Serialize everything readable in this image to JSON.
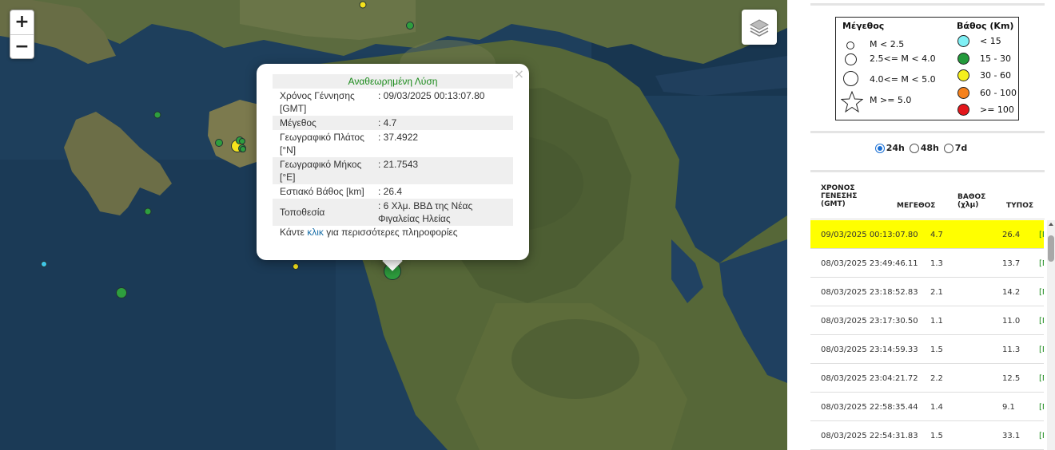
{
  "map": {
    "zoom_in_label": "+",
    "zoom_out_label": "−",
    "layers_icon": "layers-icon",
    "earthquakes": [
      {
        "depth_class": "15 - 30",
        "color": "#2e9e3e"
      },
      {
        "depth_class": "30 - 60",
        "color": "#f5e31c"
      },
      {
        "depth_class": "15 - 30",
        "color": "#2e9e3e"
      },
      {
        "depth_class": "15 - 30",
        "color": "#2e9e3e"
      },
      {
        "depth_class": "15 - 30",
        "color": "#2e9e3e"
      },
      {
        "depth_class": "30 - 60",
        "color": "#f5e31c"
      },
      {
        "depth_class": "15 - 30",
        "color": "#2e9e3e"
      },
      {
        "depth_class": "15 - 30",
        "color": "#2e9e3e"
      },
      {
        "depth_class": "15 - 30",
        "color": "#2e9e3e"
      },
      {
        "depth_class": "15 - 30",
        "color": "#2e9e3e"
      },
      {
        "depth_class": "< 15",
        "color": "#3fc6e8"
      },
      {
        "depth_class": "30 - 60",
        "color": "#f5e31c"
      },
      {
        "depth_class": "15 - 30",
        "color": "#2e9e3e"
      },
      {
        "depth_class": "15 - 30",
        "color": "#2e9e3e"
      }
    ]
  },
  "popup": {
    "title": "Αναθεωρημένη Λύση",
    "rows": [
      {
        "label": "Χρόνος Γέννησης [GMT]",
        "value": ": 09/03/2025 00:13:07.80"
      },
      {
        "label": "Μέγεθος",
        "value": ": 4.7"
      },
      {
        "label": "Γεωγραφικό Πλάτος [°N]",
        "value": ": 37.4922"
      },
      {
        "label": "Γεωγραφικό Μήκος [°E]",
        "value": ": 21.7543"
      },
      {
        "label": "Εστιακό Βάθος [km]",
        "value": ": 26.4"
      },
      {
        "label": "Τοποθεσία",
        "value": ": 6 Χλμ. ΒΒΔ της Νέας Φιγαλείας Ηλείας"
      }
    ],
    "more_prefix": "Κάντε ",
    "more_link": "κλικ",
    "more_suffix": " για περισσότερες πληροφορίες",
    "close": "×"
  },
  "legend": {
    "magnitude_title": "Μέγεθος",
    "depth_title": "Βάθος (Km)",
    "magnitudes": [
      "M < 2.5",
      "2.5<= M < 4.0",
      "4.0<= M < 5.0",
      "M >= 5.0"
    ],
    "depths": [
      {
        "label": "< 15",
        "color": "#7ff0f5"
      },
      {
        "label": "15 - 30",
        "color": "#239a3b"
      },
      {
        "label": "30 - 60",
        "color": "#f5ef1c"
      },
      {
        "label": "60 - 100",
        "color": "#f5811c"
      },
      {
        "label": ">= 100",
        "color": "#e3171c"
      }
    ]
  },
  "period": {
    "options": [
      "24h",
      "48h",
      "7d"
    ],
    "selected": "24h"
  },
  "list": {
    "headers": {
      "time": "ΧΡΟΝΟΣ ΓΕΝΕΣΗΣ (GMT)",
      "time_line1": "ΧΡΟΝΟΣ",
      "time_line2": "ΓΕΝΕΣΗΣ",
      "time_line3": "(GMT)",
      "mag": "ΜΕΓΕΘΟΣ",
      "depth_line1": "ΒΑΘΟΣ",
      "depth_line2": "(χλμ)",
      "type": "ΤΥΠΟΣ"
    },
    "rows": [
      {
        "time": "09/03/2025 00:13:07.80",
        "mag": "4.7",
        "depth": "26.4",
        "type": "[M",
        "highlighted": true
      },
      {
        "time": "08/03/2025 23:49:46.11",
        "mag": "1.3",
        "depth": "13.7",
        "type": "[M",
        "highlighted": false
      },
      {
        "time": "08/03/2025 23:18:52.83",
        "mag": "2.1",
        "depth": "14.2",
        "type": "[M",
        "highlighted": false
      },
      {
        "time": "08/03/2025 23:17:30.50",
        "mag": "1.1",
        "depth": "11.0",
        "type": "[M",
        "highlighted": false
      },
      {
        "time": "08/03/2025 23:14:59.33",
        "mag": "1.5",
        "depth": "11.3",
        "type": "[M",
        "highlighted": false
      },
      {
        "time": "08/03/2025 23:04:21.72",
        "mag": "2.2",
        "depth": "12.5",
        "type": "[M",
        "highlighted": false
      },
      {
        "time": "08/03/2025 22:58:35.44",
        "mag": "1.4",
        "depth": "9.1",
        "type": "[M",
        "highlighted": false
      },
      {
        "time": "08/03/2025 22:54:31.83",
        "mag": "1.5",
        "depth": "33.1",
        "type": "[M",
        "highlighted": false
      }
    ]
  },
  "colors": {
    "highlight": "#ffff00",
    "sea": "#1d3d5a",
    "land": "#5a6a3c",
    "popup_title": "#1a8a1a"
  }
}
